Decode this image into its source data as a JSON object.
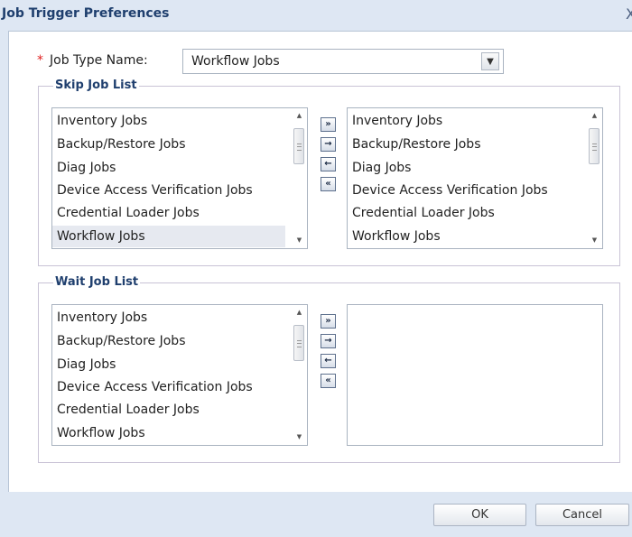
{
  "dialog": {
    "title": "Job Trigger Preferences",
    "close_glyph": "X"
  },
  "job_type": {
    "required_mark": "*",
    "label": "Job Type Name:",
    "selected": "Workflow Jobs",
    "dropdown_icon": "chevron-down-icon"
  },
  "skip_group": {
    "legend": "Skip Job List",
    "available": [
      "Inventory Jobs",
      "Backup/Restore Jobs",
      "Diag Jobs",
      "Device Access Verification Jobs",
      "Credential Loader Jobs",
      "Workflow Jobs"
    ],
    "selected_item": "Workflow Jobs",
    "chosen": [
      "Inventory Jobs",
      "Backup/Restore Jobs",
      "Diag Jobs",
      "Device Access Verification Jobs",
      "Credential Loader Jobs",
      "Workflow Jobs"
    ]
  },
  "wait_group": {
    "legend": "Wait Job List",
    "available": [
      "Inventory Jobs",
      "Backup/Restore Jobs",
      "Diag Jobs",
      "Device Access Verification Jobs",
      "Credential Loader Jobs",
      "Workflow Jobs"
    ],
    "chosen": []
  },
  "move_buttons": {
    "move_all_right": "»",
    "move_right": "→",
    "move_left": "←",
    "move_all_left": "«"
  },
  "footer": {
    "ok": "OK",
    "cancel": "Cancel"
  },
  "colors": {
    "chrome_bg": "#dee7f3",
    "title_text": "#1f3f6e",
    "required": "#e02020",
    "selection_bg": "#e6e9f0"
  }
}
